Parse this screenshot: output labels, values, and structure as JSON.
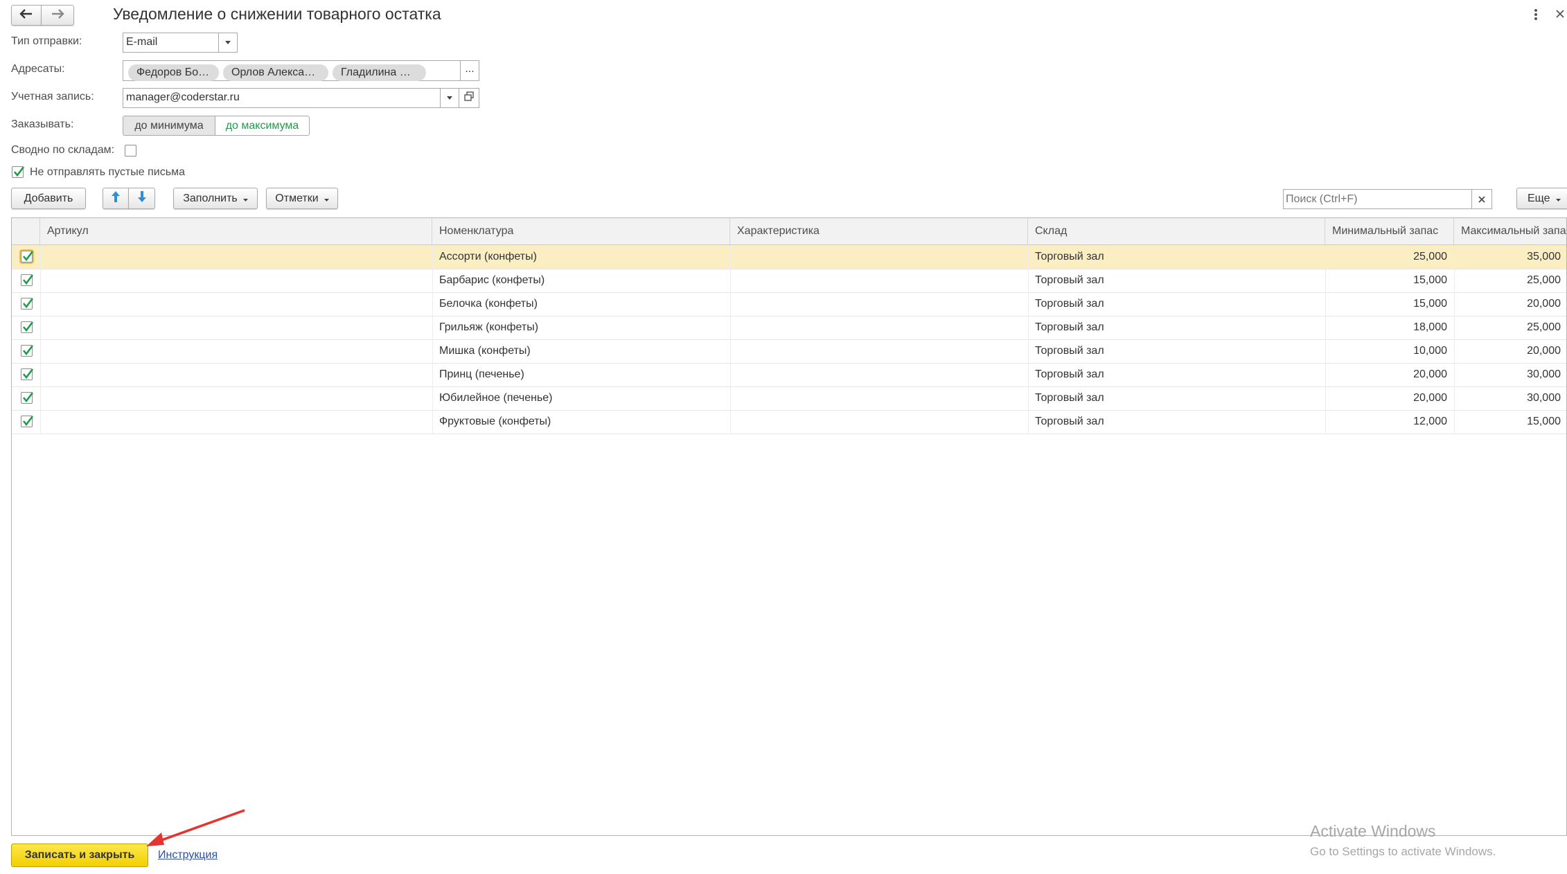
{
  "form": {
    "title": "Уведомление о снижении товарного остатка",
    "send_type_label": "Тип отправки:",
    "send_type_value": "E-mail",
    "recipients_label": "Адресаты:",
    "recipients": [
      "Федоров Бо…",
      "Орлов Алексан…",
      "Гладилина В…"
    ],
    "recipients_more": "...",
    "account_label": "Учетная запись:",
    "account_value": "manager@coderstar.ru",
    "order_label": "Заказывать:",
    "order_options": [
      "до минимума",
      "до максимума"
    ],
    "order_selected": "до максимума",
    "summary_label": "Сводно по складам:",
    "summary_checked": false,
    "no_empty_label": "Не отправлять пустые письма",
    "no_empty_checked": true
  },
  "toolbar": {
    "add_label": "Добавить",
    "fill_label": "Заполнить",
    "marks_label": "Отметки",
    "search_placeholder": "Поиск (Ctrl+F)",
    "more_label": "Еще"
  },
  "table": {
    "columns": [
      "Артикул",
      "Номенклатура",
      "Характеристика",
      "Склад",
      "Минимальный запас",
      "Максимальный запас"
    ],
    "rows": [
      {
        "checked": true,
        "article": "",
        "item": "Ассорти (конфеты)",
        "characteristic": "",
        "warehouse": "Торговый зал",
        "min": "25,000",
        "max": "35,000"
      },
      {
        "checked": true,
        "article": "",
        "item": "Барбарис (конфеты)",
        "characteristic": "",
        "warehouse": "Торговый зал",
        "min": "15,000",
        "max": "25,000"
      },
      {
        "checked": true,
        "article": "",
        "item": "Белочка (конфеты)",
        "characteristic": "",
        "warehouse": "Торговый зал",
        "min": "15,000",
        "max": "20,000"
      },
      {
        "checked": true,
        "article": "",
        "item": "Грильяж (конфеты)",
        "characteristic": "",
        "warehouse": "Торговый зал",
        "min": "18,000",
        "max": "25,000"
      },
      {
        "checked": true,
        "article": "",
        "item": "Мишка (конфеты)",
        "characteristic": "",
        "warehouse": "Торговый зал",
        "min": "10,000",
        "max": "20,000"
      },
      {
        "checked": true,
        "article": "",
        "item": "Принц (печенье)",
        "characteristic": "",
        "warehouse": "Торговый зал",
        "min": "20,000",
        "max": "30,000"
      },
      {
        "checked": true,
        "article": "",
        "item": "Юбилейное (печенье)",
        "characteristic": "",
        "warehouse": "Торговый зал",
        "min": "20,000",
        "max": "30,000"
      },
      {
        "checked": true,
        "article": "",
        "item": "Фруктовые (конфеты)",
        "characteristic": "",
        "warehouse": "Торговый зал",
        "min": "12,000",
        "max": "15,000"
      }
    ]
  },
  "footer": {
    "save_close_label": "Записать и закрыть",
    "instruction_label": "Инструкция"
  },
  "watermark": {
    "line1": "Activate Windows",
    "line2": "Go to Settings to activate Windows."
  },
  "colors": {
    "selected_row": "#fbeec2",
    "primary_button": "#f5d800",
    "check_green": "#1e9c4a",
    "arrow_blue": "#2e8fd8",
    "annotation_red": "#e3342f"
  }
}
